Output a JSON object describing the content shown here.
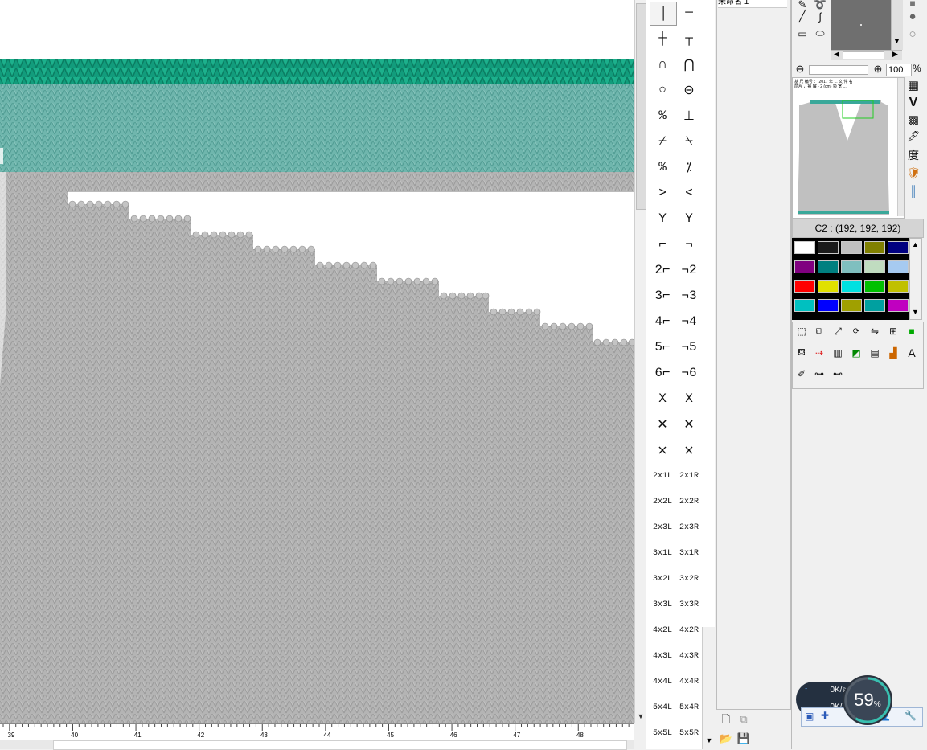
{
  "ruler": {
    "labels": [
      "39",
      "40",
      "41",
      "42",
      "43",
      "44",
      "45",
      "46",
      "47",
      "48"
    ]
  },
  "list_panel": {
    "header_text": "未命名 1"
  },
  "stitches": {
    "symbols": [
      [
        "│",
        "─"
      ],
      [
        "┼",
        "┬"
      ],
      [
        "∩",
        "⋂"
      ],
      [
        "○",
        "⊖"
      ],
      [
        "%",
        "⊥"
      ],
      [
        "⌿",
        "⍀"
      ],
      [
        "%",
        "⁒"
      ],
      [
        ">",
        "<"
      ],
      [
        "Y",
        "Y"
      ],
      [
        "⌐",
        "¬"
      ],
      [
        "2⌐",
        "¬2"
      ],
      [
        "3⌐",
        "¬3"
      ],
      [
        "4⌐",
        "¬4"
      ],
      [
        "5⌐",
        "¬5"
      ],
      [
        "6⌐",
        "¬6"
      ],
      [
        "X",
        "X"
      ],
      [
        "✕",
        "✕"
      ],
      [
        "⨯",
        "⨯"
      ]
    ],
    "labels": [
      [
        "2x1L",
        "2x1R"
      ],
      [
        "2x2L",
        "2x2R"
      ],
      [
        "2x3L",
        "2x3R"
      ],
      [
        "3x1L",
        "3x1R"
      ],
      [
        "3x2L",
        "3x2R"
      ],
      [
        "3x3L",
        "3x3R"
      ],
      [
        "4x2L",
        "4x2R"
      ],
      [
        "4x3L",
        "4x3R"
      ],
      [
        "4x4L",
        "4x4R"
      ],
      [
        "5x4L",
        "5x4R"
      ],
      [
        "5x5L",
        "5x5R"
      ]
    ]
  },
  "zoom": {
    "value": "100",
    "unit": "%"
  },
  "navigator": {
    "caption_lines": [
      "基 尺 编号 ： 2017 年 ... 文 件 名",
      "前片 ，袖 窿 - 2 (cm) 领 宽 ..."
    ],
    "colors": {
      "body": "#c0c0c0",
      "band": "#3aa89a",
      "viewport": "#22cc22"
    }
  },
  "current_color": {
    "label": "C2 : (192, 192, 192)"
  },
  "palette": {
    "rows": [
      [
        "#ffffff",
        "#1a1a1a",
        "#c0c0c0",
        "#808000",
        "#000080"
      ],
      [
        "#800080",
        "#008080",
        "#7fbfbf",
        "#c0dcc0",
        "#a6caf0"
      ],
      [
        "#ff0000",
        "#e0e000",
        "#00e0e0",
        "#00c000",
        "#c0c000"
      ],
      [
        "#00c0c0",
        "#0000ff",
        "#a0a000",
        "#00a0a0",
        "#c000c0"
      ]
    ]
  },
  "right_icons": {
    "du_char": "度"
  },
  "network": {
    "up_speed": "0",
    "down_speed": "0",
    "unit": "K/s",
    "cpu_percent": "59",
    "percent_sign": "%"
  },
  "colors": {
    "knit_gray": "#b4b4b4",
    "knit_teal": "#5fb0a6",
    "knit_teal_dark": "#1aa886",
    "canvas_bg": "#ffffff"
  }
}
